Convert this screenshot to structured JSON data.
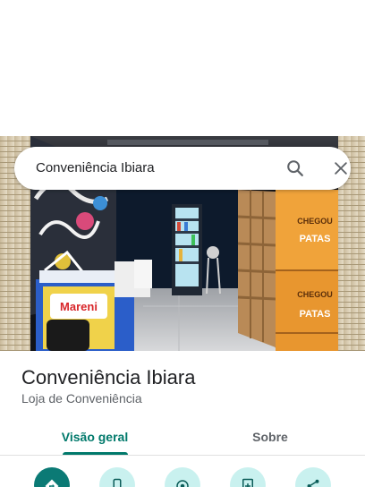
{
  "search": {
    "query": "Conveniência Ibiara",
    "search_icon": "search-icon",
    "close_icon": "close-icon"
  },
  "place": {
    "name": "Conveniência Ibiara",
    "category": "Loja de Conveniência"
  },
  "photo": {
    "freezer_brand": "Mareni",
    "product_boxes": [
      {
        "line1": "CHEGOU",
        "line2": "PATAS"
      },
      {
        "line1": "CHEGOU",
        "line2": "PATAS"
      }
    ]
  },
  "tabs": [
    {
      "label": "Visão geral",
      "active": true
    },
    {
      "label": "Sobre",
      "active": false
    }
  ],
  "actions": [
    {
      "icon": "directions-icon",
      "primary": true
    },
    {
      "icon": "phone-icon",
      "primary": false
    },
    {
      "icon": "navigate-icon",
      "primary": false
    },
    {
      "icon": "save-icon",
      "primary": false
    },
    {
      "icon": "share-icon",
      "primary": false
    }
  ],
  "colors": {
    "accent": "#00796b",
    "primary_action": "#0b7a75",
    "secondary_action": "#c9f1ef",
    "title_text": "#202124",
    "secondary_text": "#5f6368"
  }
}
